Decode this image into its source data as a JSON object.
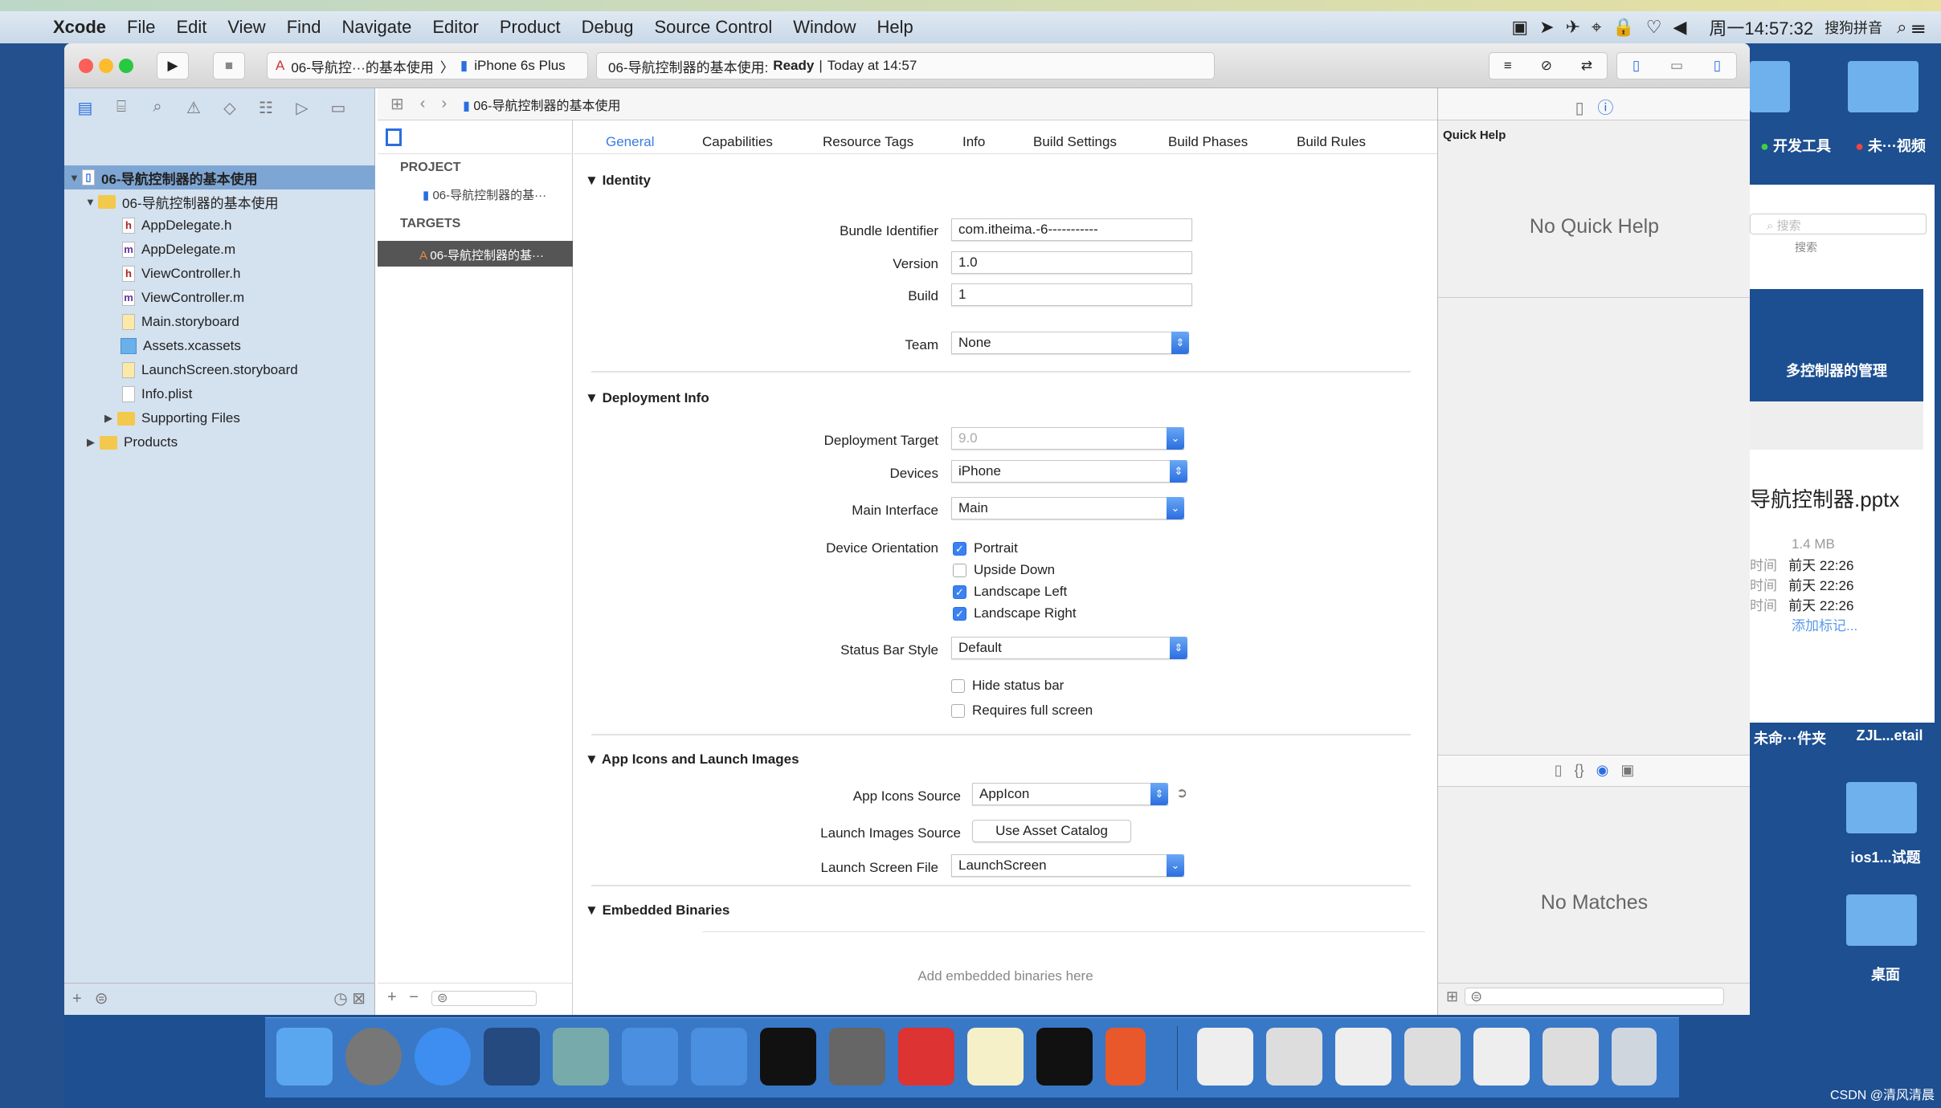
{
  "menubar": {
    "app": "Xcode",
    "items": [
      "File",
      "Edit",
      "View",
      "Find",
      "Navigate",
      "Editor",
      "Product",
      "Debug",
      "Source Control",
      "Window",
      "Help"
    ],
    "clock": "周一14:57:32",
    "input_method": "搜狗拼音"
  },
  "toolbar": {
    "scheme": "06-导航控···的基本使用",
    "device": "iPhone 6s Plus",
    "status_project": "06-导航控制器的基本使用:",
    "status_state": "Ready",
    "status_time": "Today at 14:57"
  },
  "jumpbar": {
    "path": "06-导航控制器的基本使用"
  },
  "navigator": {
    "root": "06-导航控制器的基本使用",
    "group": "06-导航控制器的基本使用",
    "files": [
      {
        "name": "AppDelegate.h",
        "icon": "h"
      },
      {
        "name": "AppDelegate.m",
        "icon": "m"
      },
      {
        "name": "ViewController.h",
        "icon": "h"
      },
      {
        "name": "ViewController.m",
        "icon": "m"
      },
      {
        "name": "Main.storyboard",
        "icon": "storyboard"
      },
      {
        "name": "Assets.xcassets",
        "icon": "assets"
      },
      {
        "name": "LaunchScreen.storyboard",
        "icon": "storyboard"
      },
      {
        "name": "Info.plist",
        "icon": "plist"
      }
    ],
    "supporting": "Supporting Files",
    "products": "Products"
  },
  "targets_list": {
    "project_header": "PROJECT",
    "project_item": "06-导航控制器的基···",
    "targets_header": "TARGETS",
    "target_item": "06-导航控制器的基···"
  },
  "tabs": [
    "General",
    "Capabilities",
    "Resource Tags",
    "Info",
    "Build Settings",
    "Build Phases",
    "Build Rules"
  ],
  "active_tab": "General",
  "identity": {
    "title": "Identity",
    "bundle_label": "Bundle Identifier",
    "bundle": "com.itheima.-6-----------",
    "version_label": "Version",
    "version": "1.0",
    "build_label": "Build",
    "build": "1",
    "team_label": "Team",
    "team": "None"
  },
  "deployment": {
    "title": "Deployment Info",
    "target_label": "Deployment Target",
    "target": "9.0",
    "devices_label": "Devices",
    "devices": "iPhone",
    "main_label": "Main Interface",
    "main": "Main",
    "orientation_label": "Device Orientation",
    "orientations": [
      {
        "label": "Portrait",
        "checked": true
      },
      {
        "label": "Upside Down",
        "checked": false
      },
      {
        "label": "Landscape Left",
        "checked": true
      },
      {
        "label": "Landscape Right",
        "checked": true
      }
    ],
    "statusbar_label": "Status Bar Style",
    "statusbar": "Default",
    "hide_status": "Hide status bar",
    "hide_checked": false,
    "full_screen": "Requires full screen",
    "full_checked": false
  },
  "app_icons": {
    "title": "App Icons and Launch Images",
    "source_label": "App Icons Source",
    "source": "AppIcon",
    "launch_label": "Launch Images Source",
    "launch_button": "Use Asset Catalog",
    "screen_label": "Launch Screen File",
    "screen": "LaunchScreen"
  },
  "embedded": {
    "title": "Embedded Binaries",
    "placeholder": "Add embedded binaries here"
  },
  "inspector": {
    "quick_help": "Quick Help",
    "no_help": "No Quick Help",
    "no_matches": "No Matches"
  },
  "desktop": {
    "folders": [
      "开发工具",
      "未···视频",
      "未命···件夹",
      "ZJL...etail",
      "ios1...试题",
      "桌面"
    ],
    "search_placeholder": "搜索",
    "search_label": "搜索",
    "preview": {
      "slide_title": "多控制器的管理",
      "filename": "导航控制器.pptx",
      "size": "1.4 MB",
      "rows": [
        {
          "k": "时间",
          "v": "前天 22:26"
        },
        {
          "k": "时间",
          "v": "前天 22:26"
        },
        {
          "k": "时间",
          "v": "前天 22:26"
        }
      ],
      "add_tag": "添加标记..."
    }
  },
  "watermark": "CSDN @清风清晨",
  "colors": {
    "accent": "#2a6ee0",
    "navigator_bg": "#d4e1ef",
    "desktop": "#1d4f91"
  }
}
